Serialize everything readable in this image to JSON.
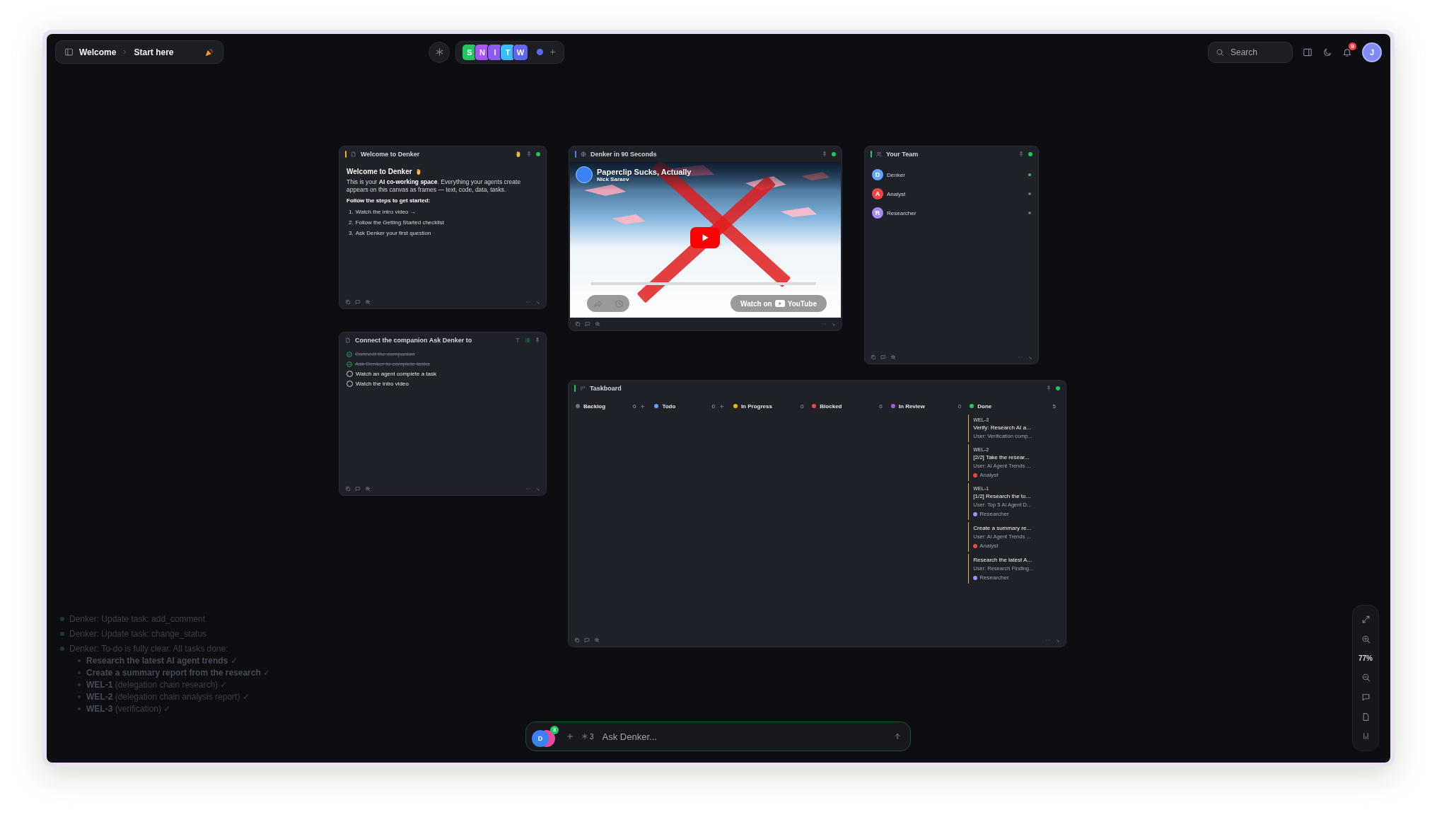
{
  "breadcrumb": [
    {
      "label": "Welcome"
    },
    {
      "label": "Start here"
    }
  ],
  "workspaces": [
    {
      "letter": "S",
      "color": "#22c55e"
    },
    {
      "letter": "N",
      "color": "#a855f7"
    },
    {
      "letter": "I",
      "color": "#8b5cf6"
    },
    {
      "letter": "T",
      "color": "#38bdf8"
    },
    {
      "letter": "W",
      "color": "#6366f1"
    }
  ],
  "search": {
    "placeholder": "Search"
  },
  "notifications": {
    "count": "9"
  },
  "user_avatar": {
    "initial": "J"
  },
  "welcome_frame": {
    "title": "Welcome to Denker",
    "live": true,
    "heading": "Welcome to Denker",
    "intro": "This is your **AI co-working space**. Everything your agents create appears on this canvas as frames — text, code, data, tasks.",
    "steps_heading": "Follow the steps to get started:",
    "steps": [
      {
        "number": "1.",
        "text": "Watch the intro video →"
      },
      {
        "number": "2.",
        "text": "Follow the Getting Started checklist"
      },
      {
        "number": "3.",
        "text": "Ask Denker your first question"
      }
    ]
  },
  "checklist_frame": {
    "title": "Connect the companion Ask Denker to",
    "items": [
      {
        "text": "Connect the companion",
        "checked": true
      },
      {
        "text": "Ask Denker to complete tasks",
        "checked": true
      },
      {
        "text": "Watch an agent complete a task",
        "checked": false
      },
      {
        "text": "Watch the intro video",
        "checked": false
      }
    ]
  },
  "video_frame": {
    "title": "Denker in 90 Seconds",
    "live": true,
    "video": {
      "kind": "picture",
      "title": "Paperclip Sucks, Actually",
      "channel": "Nick Saraev",
      "watch_label": "Watch on",
      "brand": "YouTube"
    }
  },
  "team_frame": {
    "title": "Your Team",
    "live": true,
    "members": [
      {
        "initial": "D",
        "name": "Denker",
        "color": "#60a5fa",
        "online": true
      },
      {
        "initial": "A",
        "name": "Analyst",
        "color": "#ef4444",
        "online": false
      },
      {
        "initial": "R",
        "name": "Researcher",
        "color": "#a78bfa",
        "online": false
      }
    ]
  },
  "taskboard_frame": {
    "title": "Taskboard",
    "live": true,
    "columns": [
      {
        "name": "Backlog",
        "color": "#6b7280",
        "count": "0",
        "can_add": true
      },
      {
        "name": "Todo",
        "color": "#60a5fa",
        "count": "0",
        "can_add": true
      },
      {
        "name": "In Progress",
        "color": "#eab308",
        "count": "0",
        "can_add": false
      },
      {
        "name": "Blocked",
        "color": "#ef4444",
        "count": "0",
        "can_add": false
      },
      {
        "name": "In Review",
        "color": "#a855f7",
        "count": "0",
        "can_add": false
      },
      {
        "name": "Done",
        "color": "#22c55e",
        "count": "5",
        "can_add": false,
        "cards": [
          {
            "id": "WEL-3",
            "title": "Verify: Research AI a...",
            "subtitle": "User: Verification comp..."
          },
          {
            "id": "WEL-2",
            "title": "[2/2] Take the resear...",
            "subtitle": "User: AI Agent Trends ...",
            "assignee": {
              "name": "Analyst",
              "color": "#ef4444"
            }
          },
          {
            "id": "WEL-1",
            "title": "[1/2] Research the to...",
            "subtitle": "User: Top 5 AI Agent D...",
            "assignee": {
              "name": "Researcher",
              "color": "#a78bfa"
            }
          },
          {
            "title": "Create a summary re...",
            "subtitle": "User: AI Agent Trends ...",
            "assignee": {
              "name": "Analyst",
              "color": "#ef4444"
            }
          },
          {
            "title": "Research the latest A...",
            "subtitle": "User: Research Finding...",
            "assignee": {
              "name": "Researcher",
              "color": "#a78bfa"
            }
          }
        ]
      }
    ]
  },
  "activity_log": [
    {
      "text": "Denker: Update task: add_comment"
    },
    {
      "text": "Denker: Update task: change_status"
    },
    {
      "text": "Denker: To-do is fully clear. All tasks done:",
      "items": [
        "**Research the latest AI agent trends** ✓",
        "**Create a summary report from the research** ✓",
        "**WEL-1** (delegation chain research) ✓",
        "**WEL-2** (delegation chain analysis report) ✓",
        "**WEL-3** (verification) ✓"
      ]
    }
  ],
  "composer": {
    "avatar": "D",
    "badge": "3",
    "agents": "3",
    "placeholder": "Ask Denker..."
  },
  "zoom": {
    "level_text": "77%"
  }
}
